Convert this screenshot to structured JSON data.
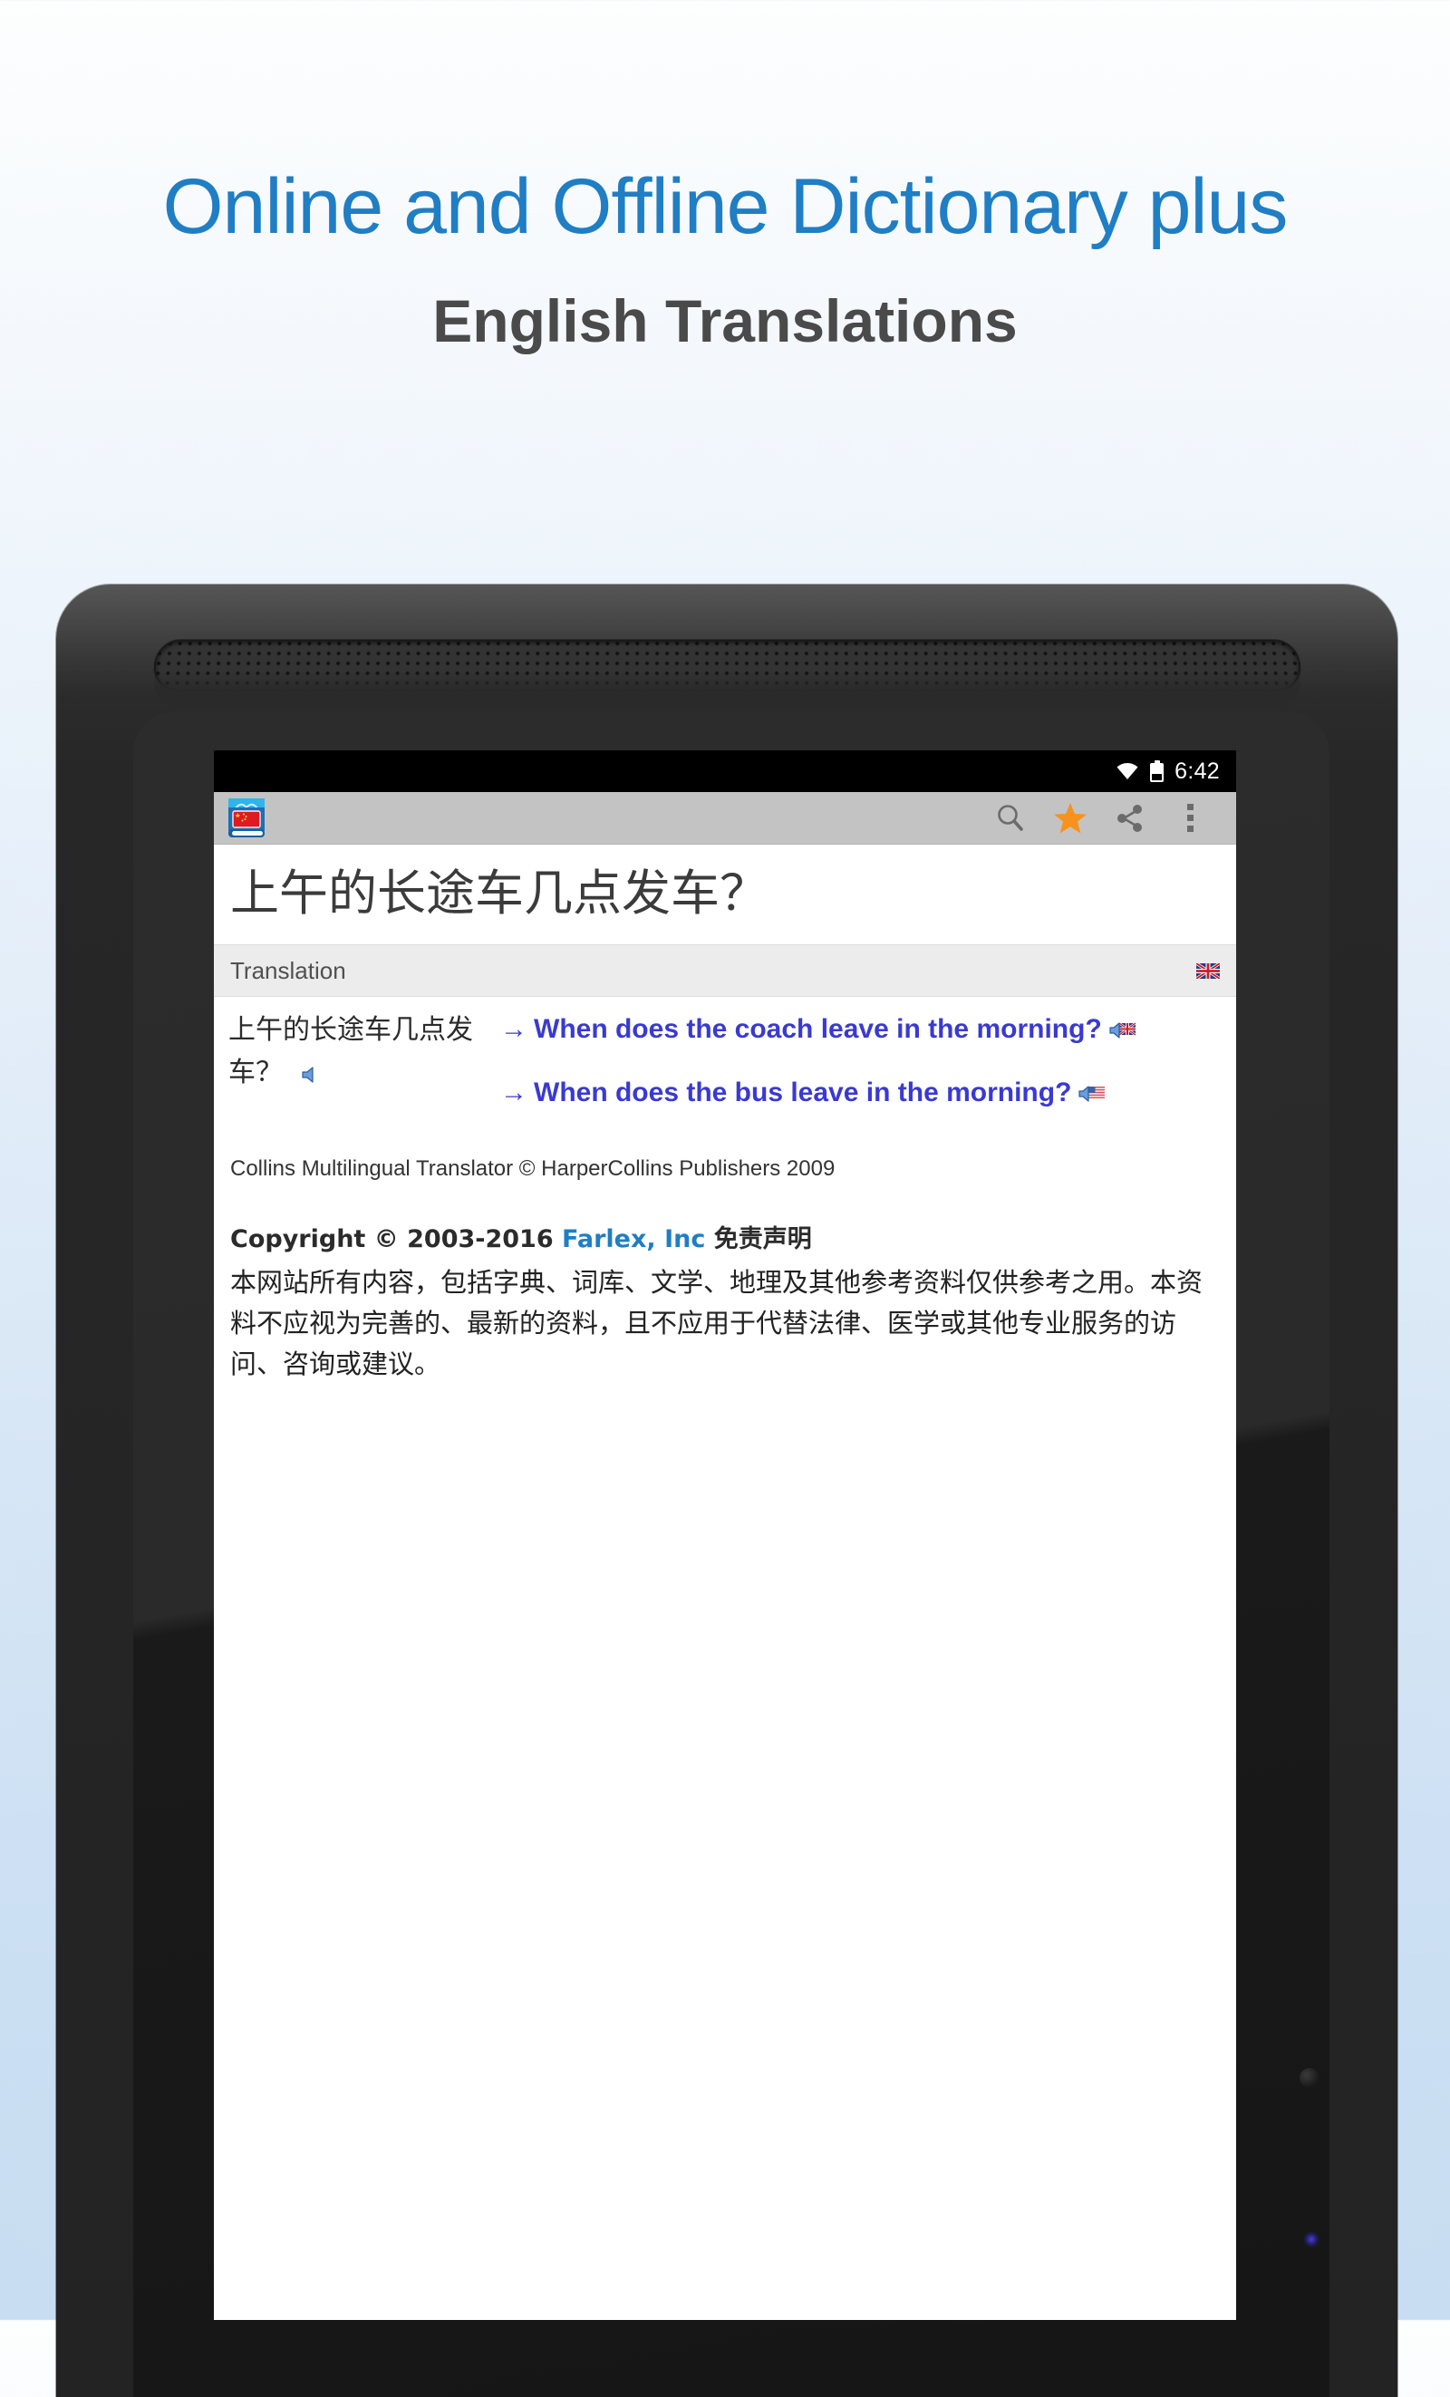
{
  "promo": {
    "line1": "Online and Offline Dictionary plus",
    "line2": "English Translations",
    "accent_color": "#1f7ec4",
    "line2_color": "#4a4a4a"
  },
  "device": {
    "type": "android-tablet",
    "bezel_color": "#272727"
  },
  "statusbar": {
    "wifi_icon": "wifi-icon",
    "battery_icon": "battery-icon",
    "time": "6:42"
  },
  "toolbar": {
    "app_icon": "chinese-dictionary-book-icon",
    "search_icon": "search-icon",
    "favorite_icon": "star-icon",
    "favorite_color": "#f7921e",
    "share_icon": "share-icon",
    "overflow_icon": "overflow-menu-icon",
    "background": "#c3c3c3"
  },
  "entry": {
    "headword": "上午的长途车几点发车？"
  },
  "section": {
    "title": "Translation",
    "flag_icon": "uk-flag-icon"
  },
  "translation": {
    "source_text": "上午的长途车几点发",
    "source_text_line2": "车？",
    "source_speaker_icon": "speaker-icon",
    "targets": [
      {
        "arrow": "→",
        "text": "When does the coach leave in the morning?",
        "speaker_icon": "speaker-uk-flag-icon"
      },
      {
        "arrow": "→",
        "text": "When does the bus leave in the morning?",
        "speaker_icon": "speaker-us-flag-icon"
      }
    ],
    "link_color": "#3a3ad0"
  },
  "credit": {
    "text": "Collins Multilingual Translator © HarperCollins Publishers 2009"
  },
  "copyright": {
    "prefix": "Copyright © 2003-2016 ",
    "company": "Farlex, Inc",
    "suffix": " 免责声明",
    "company_color": "#1f7ec4",
    "disclaimer": "本网站所有内容，包括字典、词库、文学、地理及其他参考资料仅供参考之用。本资料不应视为完善的、最新的资料，且不应用于代替法律、医学或其他专业服务的访问、咨询或建议。"
  }
}
